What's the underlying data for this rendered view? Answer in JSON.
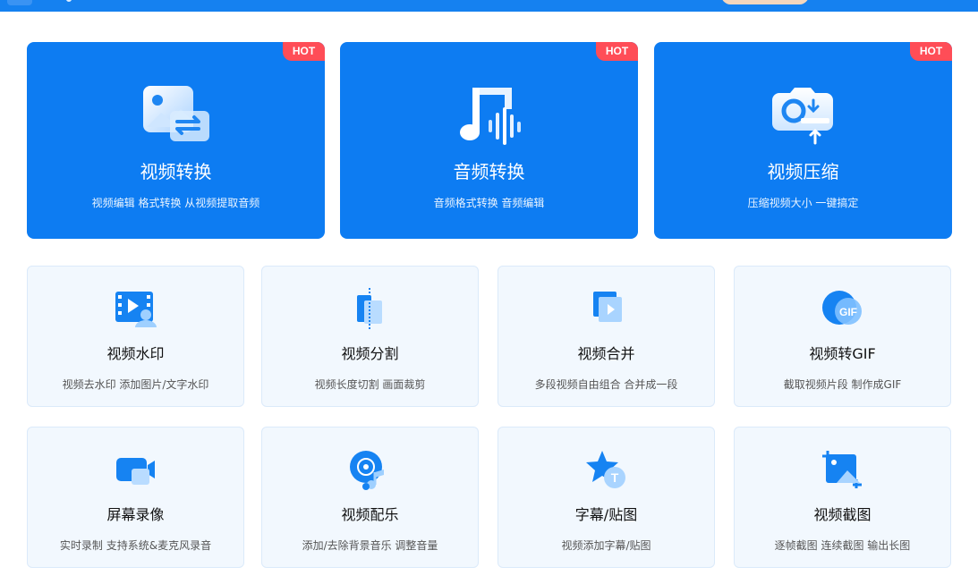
{
  "hero_cards": [
    {
      "title": "视频转换",
      "subtitle": "视频编辑 格式转换 从视频提取音频",
      "badge": "HOT",
      "icon": "video-convert-icon"
    },
    {
      "title": "音频转换",
      "subtitle": "音频格式转换 音频编辑",
      "badge": "HOT",
      "icon": "audio-convert-icon"
    },
    {
      "title": "视频压缩",
      "subtitle": "压缩视频大小 一键搞定",
      "badge": "HOT",
      "icon": "video-compress-icon"
    }
  ],
  "tools": [
    {
      "title": "视频水印",
      "subtitle": "视频去水印 添加图片/文字水印",
      "icon": "watermark-icon"
    },
    {
      "title": "视频分割",
      "subtitle": "视频长度切割 画面裁剪",
      "icon": "split-icon"
    },
    {
      "title": "视频合并",
      "subtitle": "多段视频自由组合 合并成一段",
      "icon": "merge-icon"
    },
    {
      "title": "视频转GIF",
      "subtitle": "截取视频片段 制作成GIF",
      "icon": "gif-icon",
      "icon_text": "GIF"
    },
    {
      "title": "屏幕录像",
      "subtitle": "实时录制 支持系统&麦克风录音",
      "icon": "screen-record-icon"
    },
    {
      "title": "视频配乐",
      "subtitle": "添加/去除背景音乐 调整音量",
      "icon": "music-disc-icon"
    },
    {
      "title": "字幕/贴图",
      "subtitle": "视频添加字幕/贴图",
      "icon": "subtitle-sticker-icon",
      "icon_text": "T"
    },
    {
      "title": "视频截图",
      "subtitle": "逐帧截图 连续截图 输出长图",
      "icon": "screenshot-icon"
    }
  ],
  "colors": {
    "primary": "#0d7cf2",
    "hot_badge": "#ff4d57",
    "card_bg": "#f2f8fe"
  }
}
